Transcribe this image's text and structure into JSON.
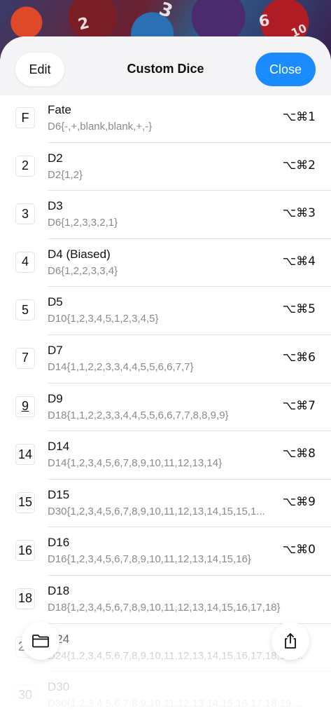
{
  "header": {
    "edit_label": "Edit",
    "title": "Custom Dice",
    "close_label": "Close"
  },
  "colors": {
    "accent": "#1a8cff",
    "subtitle": "#8a8a90"
  },
  "background_glyphs": [
    "2",
    "3",
    "6",
    "10"
  ],
  "dice": [
    {
      "badge": "F",
      "name": "Fate",
      "formula": "D6{-,+,blank,blank,+,-}",
      "shortcut": "⌥⌘1"
    },
    {
      "badge": "2",
      "name": "D2",
      "formula": "D2{1,2}",
      "shortcut": "⌥⌘2"
    },
    {
      "badge": "3",
      "name": "D3",
      "formula": "D6{1,2,3,3,2,1}",
      "shortcut": "⌥⌘3"
    },
    {
      "badge": "4",
      "name": "D4 (Biased)",
      "formula": "D6{1,2,2,3,3,4}",
      "shortcut": "⌥⌘4"
    },
    {
      "badge": "5",
      "name": "D5",
      "formula": "D10{1,2,3,4,5,1,2,3,4,5}",
      "shortcut": "⌥⌘5"
    },
    {
      "badge": "7",
      "name": "D7",
      "formula": "D14{1,1,2,2,3,3,4,4,5,5,6,6,7,7}",
      "shortcut": "⌥⌘6"
    },
    {
      "badge": "9",
      "name": "D9",
      "formula": "D18{1,1,2,2,3,3,4,4,5,5,6,6,7,7,8,8,9,9}",
      "shortcut": "⌥⌘7"
    },
    {
      "badge": "14",
      "name": "D14",
      "formula": "D14{1,2,3,4,5,6,7,8,9,10,11,12,13,14}",
      "shortcut": "⌥⌘8"
    },
    {
      "badge": "15",
      "name": "D15",
      "formula": "D30{1,2,3,4,5,6,7,8,9,10,11,12,13,14,15,15,1...",
      "shortcut": "⌥⌘9"
    },
    {
      "badge": "16",
      "name": "D16",
      "formula": "D16{1,2,3,4,5,6,7,8,9,10,11,12,13,14,15,16}",
      "shortcut": "⌥⌘0"
    },
    {
      "badge": "18",
      "name": "D18",
      "formula": "D18{1,2,3,4,5,6,7,8,9,10,11,12,13,14,15,16,17,18}",
      "shortcut": ""
    },
    {
      "badge": "24",
      "name": "D24",
      "formula": "D24{1,2,3,4,5,6,7,8,9,10,11,12,13,14,15,16,17,18,19,...",
      "shortcut": ""
    },
    {
      "badge": "30",
      "name": "D30",
      "formula": "D30{1,2,3,4,5,6,7,8,9,10,11,12,13,14,15,16,17,18,19,...",
      "shortcut": ""
    }
  ],
  "toolbar": {
    "left_icon": "folder-icon",
    "right_icon": "share-icon"
  }
}
